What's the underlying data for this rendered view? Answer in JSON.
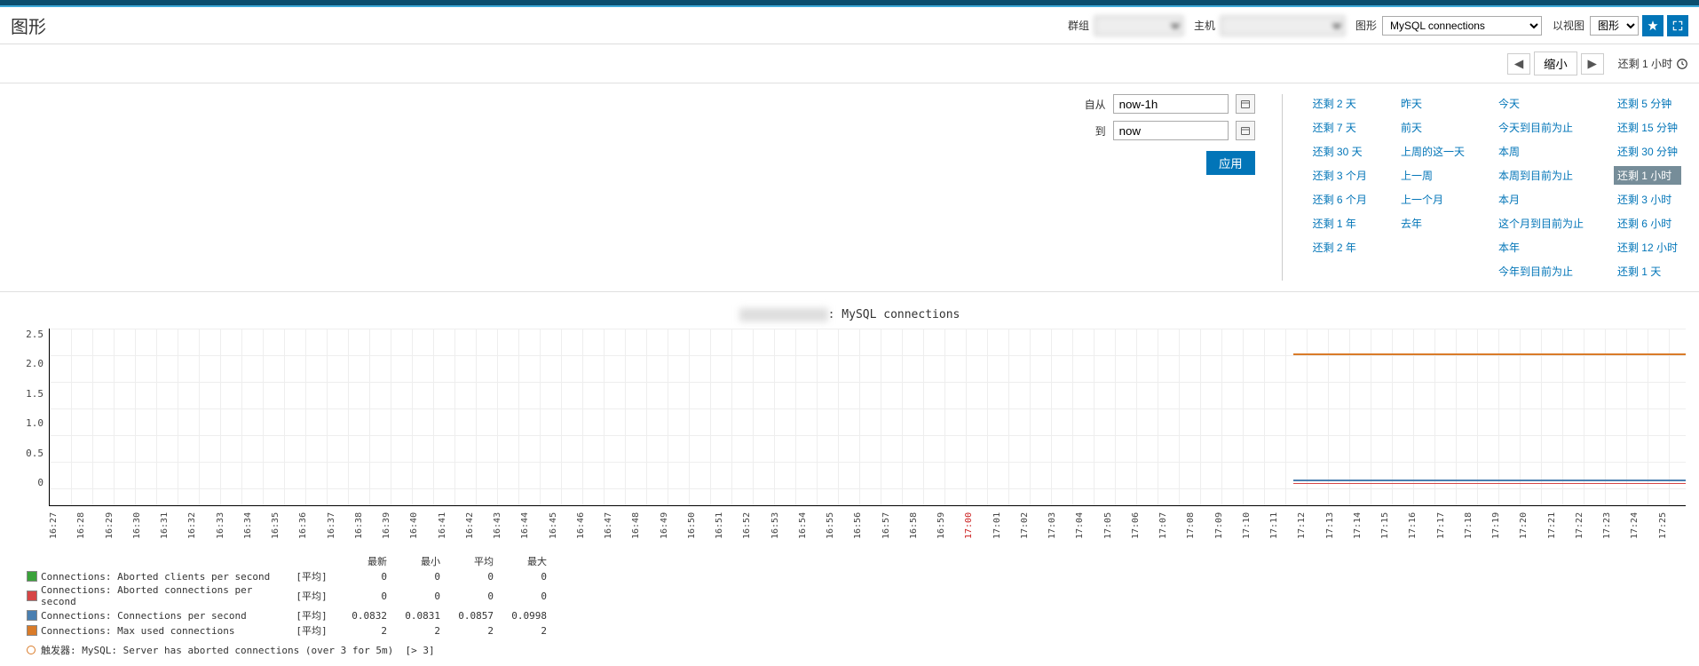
{
  "page_title": "图形",
  "filters": {
    "group_label": "群组",
    "host_label": "主机",
    "graph_label": "图形",
    "graph_value": "MySQL connections",
    "view_label": "以视图",
    "view_value": "图形"
  },
  "nav": {
    "zoom_out": "缩小",
    "current_range": "还剩 1 小时"
  },
  "time_form": {
    "from_label": "自从",
    "from_value": "now-1h",
    "to_label": "到",
    "to_value": "now",
    "apply": "应用"
  },
  "quick_col1": [
    "还剩 2 天",
    "还剩 7 天",
    "还剩 30 天",
    "还剩 3 个月",
    "还剩 6 个月",
    "还剩 1 年",
    "还剩 2 年"
  ],
  "quick_col2": [
    "昨天",
    "前天",
    "上周的这一天",
    "上一周",
    "上一个月",
    "去年"
  ],
  "quick_col3": [
    "今天",
    "今天到目前为止",
    "本周",
    "本周到目前为止",
    "本月",
    "这个月到目前为止",
    "本年",
    "今年到目前为止"
  ],
  "quick_col4": [
    "还剩 5 分钟",
    "还剩 15 分钟",
    "还剩 30 分钟",
    "还剩 1 小时",
    "还剩 3 小时",
    "还剩 6 小时",
    "还剩 12 小时",
    "还剩 1 天"
  ],
  "quick_active": "还剩 1 小时",
  "chart_title_suffix": ": MySQL connections",
  "chart_data": {
    "type": "line",
    "title": "MySQL connections",
    "ylim": [
      0,
      2.5
    ],
    "y_ticks": [
      "2.5",
      "2.0",
      "1.5",
      "1.0",
      "0.5",
      "0"
    ],
    "x_start": "12-02 16:26",
    "x_end": "12-02 17:26",
    "x_ticks": [
      "16:27",
      "16:28",
      "16:29",
      "16:30",
      "16:31",
      "16:32",
      "16:33",
      "16:34",
      "16:35",
      "16:36",
      "16:37",
      "16:38",
      "16:39",
      "16:40",
      "16:41",
      "16:42",
      "16:43",
      "16:44",
      "16:45",
      "16:46",
      "16:47",
      "16:48",
      "16:49",
      "16:50",
      "16:51",
      "16:52",
      "16:53",
      "16:54",
      "16:55",
      "16:56",
      "16:57",
      "16:58",
      "16:59",
      "17:00",
      "17:01",
      "17:02",
      "17:03",
      "17:04",
      "17:05",
      "17:06",
      "17:07",
      "17:08",
      "17:09",
      "17:10",
      "17:11",
      "17:12",
      "17:13",
      "17:14",
      "17:15",
      "17:16",
      "17:17",
      "17:18",
      "17:19",
      "17:20",
      "17:21",
      "17:22",
      "17:23",
      "17:24",
      "17:25"
    ],
    "x_red_index": 33,
    "series": [
      {
        "name": "Connections: Aborted clients per second",
        "color": "#3aa23a",
        "values_from": "17:13",
        "value": 0
      },
      {
        "name": "Connections: Aborted connections per second",
        "color": "#d64545",
        "values_from": "17:13",
        "value": 0
      },
      {
        "name": "Connections: Connections per second",
        "color": "#4a7fb0",
        "values_from": "17:13",
        "value": 0.09
      },
      {
        "name": "Connections: Max used connections",
        "color": "#d97b29",
        "values_from": "17:13",
        "value": 2
      }
    ]
  },
  "legend": {
    "headers": [
      "最新",
      "最小",
      "平均",
      "最大"
    ],
    "agg_label": "[平均]",
    "rows": [
      {
        "color": "#3aa23a",
        "name": "Connections: Aborted clients per second",
        "last": "0",
        "min": "0",
        "avg": "0",
        "max": "0"
      },
      {
        "color": "#d64545",
        "name": "Connections: Aborted connections per second",
        "last": "0",
        "min": "0",
        "avg": "0",
        "max": "0"
      },
      {
        "color": "#4a7fb0",
        "name": "Connections: Connections per second",
        "last": "0.0832",
        "min": "0.0831",
        "avg": "0.0857",
        "max": "0.0998"
      },
      {
        "color": "#d97b29",
        "name": "Connections: Max used connections",
        "last": "2",
        "min": "2",
        "avg": "2",
        "max": "2"
      }
    ],
    "trigger_label": "触发器:",
    "trigger_text": "MySQL: Server has aborted connections (over 3 for 5m)",
    "trigger_cond": "[> 3]"
  }
}
